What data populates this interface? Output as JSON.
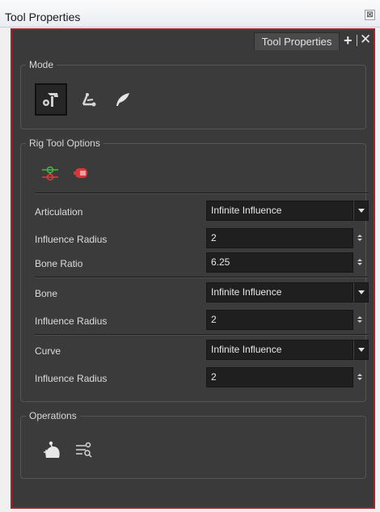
{
  "window": {
    "title": "Tool Properties",
    "close_glyph": "⊠"
  },
  "tab": {
    "label": "Tool Properties",
    "add_glyph": "+",
    "close_glyph": "✕"
  },
  "mode": {
    "label": "Mode",
    "tools": [
      {
        "icon": "rig-tool-icon",
        "selected": true
      },
      {
        "icon": "transform-tool-icon",
        "selected": false
      },
      {
        "icon": "deform-tool-icon",
        "selected": false
      }
    ]
  },
  "rig_options": {
    "label": "Rig Tool Options",
    "rows": [
      {
        "label": "Articulation",
        "value": "Infinite Influence",
        "kind": "select"
      },
      {
        "label": "Influence Radius",
        "value": "2",
        "kind": "spin"
      },
      {
        "label": "Bone Ratio",
        "value": "6.25",
        "kind": "spin"
      },
      {
        "label": "Bone",
        "value": "Infinite Influence",
        "kind": "select"
      },
      {
        "label": "Influence Radius",
        "value": "2",
        "kind": "spin"
      },
      {
        "label": "Curve",
        "value": "Infinite Influence",
        "kind": "select"
      },
      {
        "label": "Influence Radius",
        "value": "2",
        "kind": "spin"
      }
    ]
  },
  "operations": {
    "label": "Operations"
  },
  "colors": {
    "panel_bg": "#3a3a3a",
    "panel_border": "#a3242a",
    "field_bg": "#1f1f1f"
  }
}
